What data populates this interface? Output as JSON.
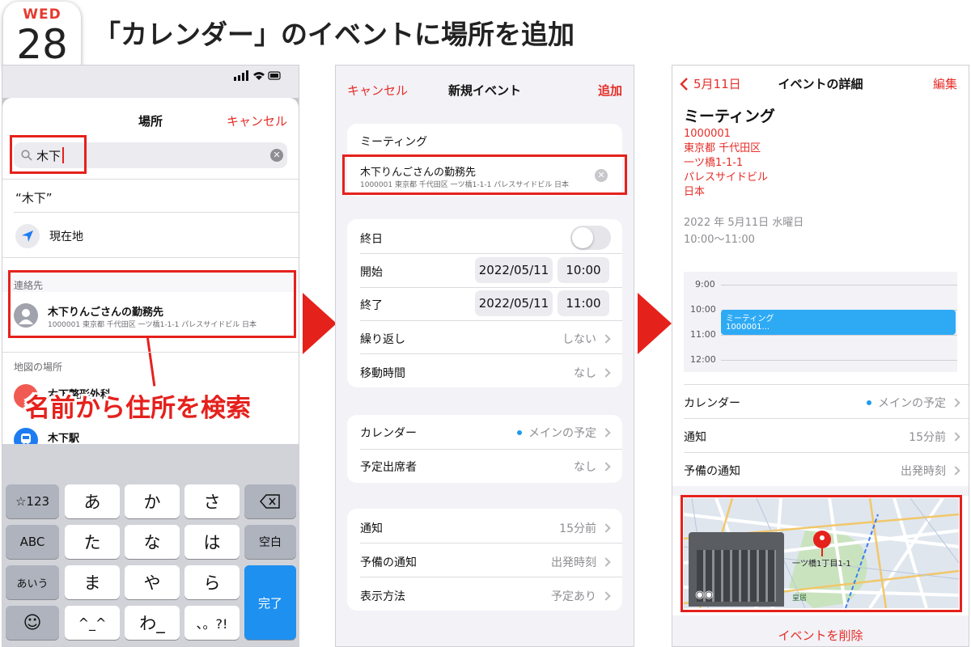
{
  "header": {
    "weekday": "WED",
    "day": "28",
    "title": "「カレンダー」のイベントに場所を追加"
  },
  "p1": {
    "nav_title": "場所",
    "cancel": "キャンセル",
    "search_value": "木下",
    "suggest_quote": "“木下”",
    "current_location": "現在地",
    "section_contacts": "連絡先",
    "contact_name": "木下りんごさんの勤務先",
    "contact_addr": "1000001 東京都 千代田区 一ツ橋1-1-1 パレスサイドビル 日本",
    "section_map": "地図の場所",
    "map_item1": "木下整形外科",
    "map_item2": "木下駅",
    "callout": "名前から住所を検索",
    "keys": {
      "k123": "☆123",
      "abc": "ABC",
      "aiu": "あいう",
      "emoji": "☺",
      "a": "あ",
      "ka": "か",
      "sa": "さ",
      "ta": "た",
      "na": "な",
      "ha": "は",
      "ma": "ま",
      "ya": "や",
      "ra": "ら",
      "face": "^_^",
      "wa": "わ_",
      "punct": "、。?!",
      "space": "空白",
      "done": "完了"
    }
  },
  "p2": {
    "cancel": "キャンセル",
    "title": "新規イベント",
    "add": "追加",
    "event_title": "ミーティング",
    "loc_name": "木下りんごさんの勤務先",
    "loc_addr": "1000001 東京都 千代田区 一ツ橋1-1-1 パレスサイドビル 日本",
    "allday": "終日",
    "start": "開始",
    "start_date": "2022/05/11",
    "start_time": "10:00",
    "end": "終了",
    "end_date": "2022/05/11",
    "end_time": "11:00",
    "repeat": "繰り返し",
    "repeat_val": "しない",
    "travel": "移動時間",
    "travel_val": "なし",
    "calendar": "カレンダー",
    "calendar_val": "メインの予定",
    "invitees": "予定出席者",
    "invitees_val": "なし",
    "alert": "通知",
    "alert_val": "15分前",
    "alert2": "予備の通知",
    "alert2_val": "出発時刻",
    "showas": "表示方法",
    "showas_val": "予定あり"
  },
  "p3": {
    "back": "5月11日",
    "title": "イベントの詳細",
    "edit": "編集",
    "event_title": "ミーティング",
    "addr_lines": [
      "1000001",
      "東京都 千代田区",
      "一ツ橋1-1-1",
      "パレスサイドビル",
      "日本"
    ],
    "date": "2022 年 5月11日 水曜日",
    "time": "10:00～11:00",
    "hours": [
      "9:00",
      "10:00",
      "11:00",
      "12:00"
    ],
    "block_title": "ミーティング",
    "block_sub": "1000001...",
    "calendar": "カレンダー",
    "calendar_val": "メインの予定",
    "alert": "通知",
    "alert_val": "15分前",
    "alert2": "予備の通知",
    "alert2_val": "出発時刻",
    "map_label": "一ツ橋1丁目1-1",
    "map_palace": "皇居",
    "delete": "イベントを削除"
  },
  "colors": {
    "accent_red": "#e52d27",
    "highlight_red": "#e5211c",
    "ios_blue": "#1e9bf0",
    "event_blue": "#2eaaf5"
  }
}
